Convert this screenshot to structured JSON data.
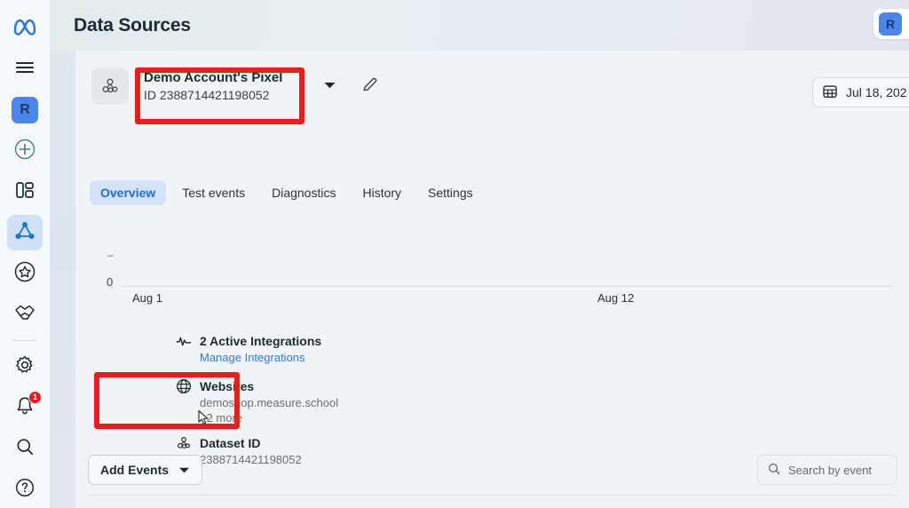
{
  "header": {
    "title": "Data Sources",
    "avatar_initial": "R",
    "avatar_icon": "user-avatar"
  },
  "rail": {
    "items": [
      {
        "name": "meta-logo",
        "icon": "meta-infinity-logo",
        "selected": false
      },
      {
        "name": "menu",
        "icon": "hamburger-menu-icon",
        "selected": false
      },
      {
        "name": "account-avatar",
        "icon": "avatar-square",
        "label": "R",
        "selected": false
      },
      {
        "name": "create",
        "icon": "plus-circle-icon",
        "selected": false
      },
      {
        "name": "dashboard",
        "icon": "dashboard-grid-icon",
        "selected": false
      },
      {
        "name": "data-sources",
        "icon": "data-sources-node-icon",
        "selected": true
      },
      {
        "name": "favorites",
        "icon": "star-circle-icon",
        "selected": false
      },
      {
        "name": "partnerships",
        "icon": "handshake-icon",
        "selected": false
      },
      {
        "name": "settings",
        "icon": "gear-icon",
        "selected": false
      },
      {
        "name": "notifications",
        "icon": "bell-icon",
        "badge": "1",
        "selected": false
      },
      {
        "name": "search",
        "icon": "search-icon",
        "selected": false
      },
      {
        "name": "help",
        "icon": "question-circle-icon",
        "selected": false
      }
    ],
    "notification_badge": "1"
  },
  "source": {
    "icon": "pixel-dataset-icon",
    "name": "Demo Account's Pixel",
    "id_label": "ID 2388714421198052",
    "caret_icon": "chevron-down-icon",
    "edit_icon": "pencil-edit-icon"
  },
  "date_picker": {
    "icon": "calendar-grid-icon",
    "value": "Jul 18, 202"
  },
  "tabs": [
    {
      "label": "Overview",
      "active": true
    },
    {
      "label": "Test events",
      "active": false
    },
    {
      "label": "Diagnostics",
      "active": false
    },
    {
      "label": "History",
      "active": false
    },
    {
      "label": "Settings",
      "active": false
    }
  ],
  "chart_data": {
    "type": "line",
    "title": "",
    "xlabel": "",
    "ylabel": "",
    "x_ticks": [
      "Aug 1",
      "Aug 12"
    ],
    "y_ticks": [
      "0"
    ],
    "y_dash_tick": "–",
    "categories": [
      "Aug 1",
      "Aug 12"
    ],
    "values": [
      0,
      0
    ],
    "ylim": [
      0,
      0
    ],
    "grid": false,
    "legend": "none"
  },
  "info": {
    "integrations": {
      "icon": "activity-pulse-icon",
      "title": "2 Active Integrations",
      "link": "Manage Integrations"
    },
    "websites": {
      "icon": "globe-icon",
      "title": "Websites",
      "value": "demoshop.measure.school",
      "more": "+2 more"
    },
    "dataset": {
      "icon": "pixel-dataset-icon",
      "title": "Dataset ID",
      "value": "2388714421198052"
    }
  },
  "footer": {
    "add_events_label": "Add Events",
    "add_events_caret": "chevron-down-icon",
    "search_icon": "search-icon",
    "search_placeholder": "Search by event"
  },
  "annotations": {
    "color": "#ec1c1c",
    "boxes": [
      "source-name-highlight",
      "dataset-id-highlight"
    ]
  }
}
